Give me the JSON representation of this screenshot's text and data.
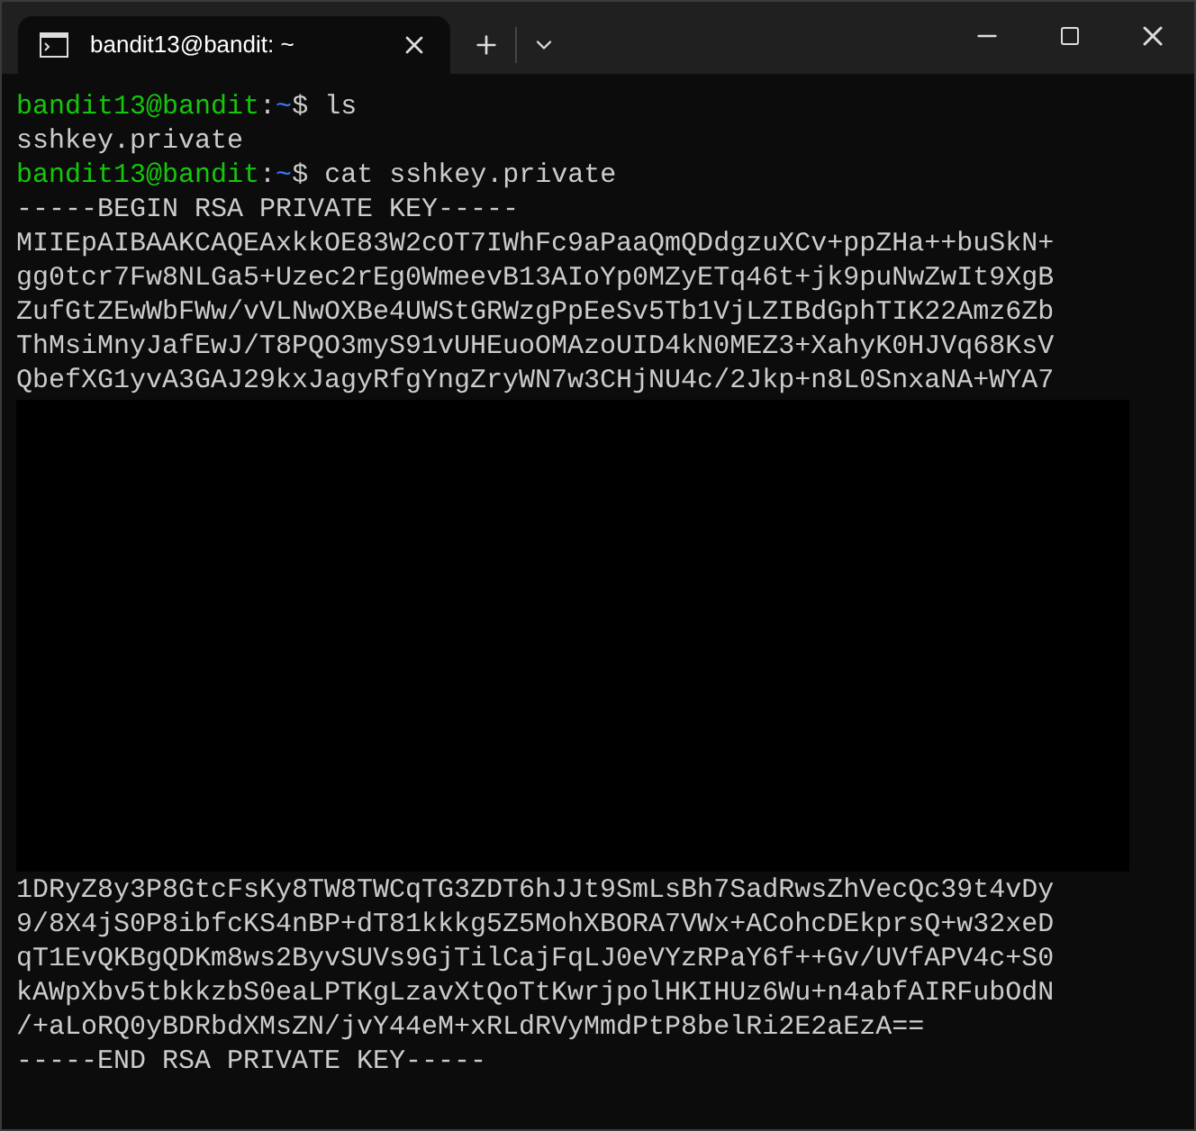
{
  "tab": {
    "title": "bandit13@bandit: ~",
    "selected": true
  },
  "terminal": {
    "lines": [
      {
        "kind": "prompt",
        "user": "bandit13@bandit",
        "separator": ":",
        "path": "~",
        "symbol": "$",
        "command": "ls"
      },
      {
        "kind": "output",
        "text": "sshkey.private"
      },
      {
        "kind": "prompt",
        "user": "bandit13@bandit",
        "separator": ":",
        "path": "~",
        "symbol": "$",
        "command": "cat sshkey.private"
      },
      {
        "kind": "output",
        "text": "-----BEGIN RSA PRIVATE KEY-----"
      },
      {
        "kind": "output",
        "text": "MIIEpAIBAAKCAQEAxkkOE83W2cOT7IWhFc9aPaaQmQDdgzuXCv+ppZHa++buSkN+"
      },
      {
        "kind": "output",
        "text": "gg0tcr7Fw8NLGa5+Uzec2rEg0WmeevB13AIoYp0MZyETq46t+jk9puNwZwIt9XgB"
      },
      {
        "kind": "output",
        "text": "ZufGtZEwWbFWw/vVLNwOXBe4UWStGRWzgPpEeSv5Tb1VjLZIBdGphTIK22Amz6Zb"
      },
      {
        "kind": "output",
        "text": "ThMsiMnyJafEwJ/T8PQO3myS91vUHEuoOMAzoUID4kN0MEZ3+XahyK0HJVq68KsV"
      },
      {
        "kind": "output",
        "text": "QbefXG1yvA3GAJ29kxJagyRfgYngZryWN7w3CHjNU4c/2Jkp+n8L0SnxaNA+WYA7"
      },
      {
        "kind": "redacted"
      },
      {
        "kind": "output",
        "text": "1DRyZ8y3P8GtcFsKy8TW8TWCqTG3ZDT6hJJt9SmLsBh7SadRwsZhVecQc39t4vDy"
      },
      {
        "kind": "output",
        "text": "9/8X4jS0P8ibfcKS4nBP+dT81kkkg5Z5MohXBORA7VWx+ACohcDEkprsQ+w32xeD"
      },
      {
        "kind": "output",
        "text": "qT1EvQKBgQDKm8ws2ByvSUVs9GjTilCajFqLJ0eVYzRPaY6f++Gv/UVfAPV4c+S0"
      },
      {
        "kind": "output",
        "text": "kAWpXbv5tbkkzbS0eaLPTKgLzavXtQoTtKwrjpolHKIHUz6Wu+n4abfAIRFubOdN"
      },
      {
        "kind": "output",
        "text": "/+aLoRQ0yBDRbdXMsZN/jvY44eM+xRLdRVyMmdPtP8belRi2E2aEzA=="
      },
      {
        "kind": "output",
        "text": "-----END RSA PRIVATE KEY-----"
      }
    ]
  }
}
